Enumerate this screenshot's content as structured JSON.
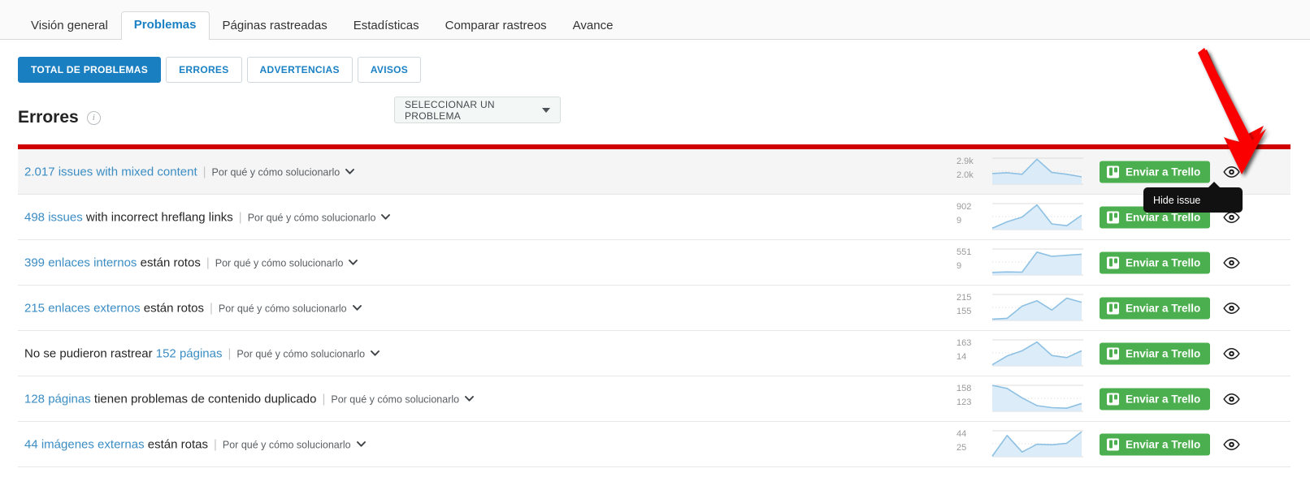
{
  "nav": {
    "tabs": [
      {
        "label": "Visión general",
        "active": false
      },
      {
        "label": "Problemas",
        "active": true
      },
      {
        "label": "Páginas rastreadas",
        "active": false
      },
      {
        "label": "Estadísticas",
        "active": false
      },
      {
        "label": "Comparar rastreos",
        "active": false
      },
      {
        "label": "Avance",
        "active": false
      }
    ]
  },
  "filters": {
    "buttons": [
      {
        "label": "TOTAL DE PROBLEMAS",
        "primary": true
      },
      {
        "label": "ERRORES",
        "primary": false
      },
      {
        "label": "ADVERTENCIAS",
        "primary": false
      },
      {
        "label": "AVISOS",
        "primary": false
      }
    ],
    "select": {
      "value": "SELECCIONAR UN PROBLEMA",
      "icon": "chevron-down-icon"
    }
  },
  "section": {
    "title": "Errores",
    "info_icon": "info-icon",
    "severity_color": "#d10000"
  },
  "common": {
    "why_label": "Por qué y cómo solucionarlo",
    "trello_label": "Enviar a Trello",
    "trello_icon": "trello-icon",
    "trello_color": "#4caf4f",
    "eye_icon": "eye-icon",
    "separator": "|"
  },
  "tooltip": {
    "text": "Hide issue"
  },
  "rows": [
    {
      "count": "2.017",
      "count_text": "2.017 issues with mixed content",
      "lead": "2.017 issues with mixed content",
      "lead_blue": true,
      "rest": "",
      "tail": "",
      "hover": true,
      "trello": true,
      "chart": {
        "hi": "2.9k",
        "lo": "2.0k",
        "values": [
          41,
          44,
          38,
          96,
          45,
          38,
          28
        ]
      }
    },
    {
      "count": "498 issues",
      "lead": "498 issues",
      "lead_blue": true,
      "rest": " with incorrect hreflang links",
      "tail": "",
      "hover": false,
      "trello": true,
      "chart": {
        "hi": "902",
        "lo": "9",
        "values": [
          5,
          30,
          48,
          95,
          22,
          15,
          55
        ]
      }
    },
    {
      "count": "399 enlaces internos",
      "lead": "399 enlaces internos",
      "lead_blue": true,
      "rest": " están rotos",
      "tail": "",
      "hover": false,
      "trello": true,
      "chart": {
        "hi": "551",
        "lo": "9",
        "values": [
          10,
          12,
          11,
          88,
          72,
          76,
          80
        ]
      }
    },
    {
      "count": "215 enlaces externos",
      "lead": "215 enlaces externos",
      "lead_blue": true,
      "rest": " están rotos",
      "tail": "",
      "hover": false,
      "trello": true,
      "chart": {
        "hi": "215",
        "lo": "155",
        "values": [
          5,
          8,
          55,
          76,
          40,
          86,
          70
        ]
      }
    },
    {
      "count": "152 páginas",
      "lead": "No se pudieron rastrear ",
      "lead_blue": false,
      "rest": "152 páginas",
      "rest_blue": true,
      "tail": "",
      "hover": false,
      "trello": true,
      "chart": {
        "hi": "163",
        "lo": "14",
        "values": [
          4,
          38,
          58,
          92,
          40,
          32,
          58
        ]
      }
    },
    {
      "count": "128 páginas",
      "lead": "128 páginas",
      "lead_blue": true,
      "rest": " tienen problemas de contenido duplicado",
      "tail": "",
      "hover": false,
      "trello": true,
      "chart": {
        "hi": "158",
        "lo": "123",
        "values": [
          100,
          88,
          52,
          22,
          14,
          12,
          30
        ]
      }
    },
    {
      "count": "44 imágenes externas",
      "lead": "44 imágenes externas",
      "lead_blue": true,
      "rest": " están rotas",
      "tail": "",
      "hover": false,
      "trello": true,
      "chart": {
        "hi": "44",
        "lo": "25",
        "values": [
          2,
          82,
          18,
          48,
          46,
          52,
          96
        ]
      }
    }
  ],
  "annotation": {
    "type": "red-arrow",
    "color": "#fa0000",
    "points_to": "eye-icon"
  }
}
